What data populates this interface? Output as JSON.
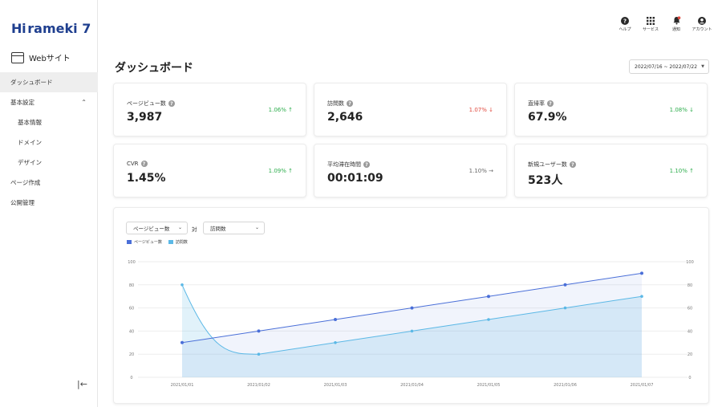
{
  "brand": {
    "logo_mark": "Hi",
    "logo_text": "rameki 7"
  },
  "site_switcher": {
    "label": "Webサイト"
  },
  "sidebar": {
    "items": [
      {
        "label": "ダッシュボード",
        "active": true
      },
      {
        "label": "基本設定",
        "expanded": true,
        "chevron": "chevron-up-icon"
      },
      {
        "label": "基本情報",
        "sub": true
      },
      {
        "label": "ドメイン",
        "sub": true
      },
      {
        "label": "デザイン",
        "sub": true
      },
      {
        "label": "ページ作成"
      },
      {
        "label": "公開管理"
      }
    ],
    "collapse_icon": "collapse-left-icon"
  },
  "top_actions": [
    {
      "label": "ヘルプ",
      "icon": "help-icon"
    },
    {
      "label": "サービス",
      "icon": "grid-icon"
    },
    {
      "label": "通知",
      "icon": "bell-icon"
    },
    {
      "label": "アカウント",
      "icon": "account-icon"
    }
  ],
  "page": {
    "title": "ダッシュボード",
    "date_range": "2022/07/16 ~ 2022/07/22"
  },
  "metrics": [
    {
      "label": "ページビュー数",
      "value": "3,987",
      "change": "1.06%",
      "trend": "up",
      "arrow": "↑"
    },
    {
      "label": "訪問数",
      "value": "2,646",
      "change": "1.07%",
      "trend": "down",
      "arrow": "↓"
    },
    {
      "label": "直帰率",
      "value": "67.9%",
      "change": "1.08%",
      "trend": "up",
      "arrow": "↓"
    },
    {
      "label": "CVR",
      "value": "1.45%",
      "change": "1.09%",
      "trend": "up",
      "arrow": "↑"
    },
    {
      "label": "平均滞在時間",
      "value": "00:01:09",
      "change": "1.10%",
      "trend": "flat",
      "arrow": "→"
    },
    {
      "label": "新規ユーザー数",
      "value": "523人",
      "change": "1.10%",
      "trend": "up",
      "arrow": "↑"
    }
  ],
  "chart_controls": {
    "metric_a": "ページビュー数",
    "vs_label": "対",
    "metric_b": "訪問数"
  },
  "chart_data": {
    "type": "area",
    "categories": [
      "2021/01/01",
      "2021/01/02",
      "2021/01/03",
      "2021/01/04",
      "2021/01/05",
      "2021/01/06",
      "2021/01/07"
    ],
    "series": [
      {
        "name": "ページビュー数",
        "values": [
          30,
          40,
          50,
          60,
          70,
          80,
          90
        ],
        "color": "#4a6fd8"
      },
      {
        "name": "訪問数",
        "values": [
          80,
          20,
          30,
          40,
          50,
          60,
          70
        ],
        "color": "#5bb8e6"
      }
    ],
    "ylim": [
      0,
      100
    ],
    "yticks": [
      0,
      20,
      40,
      60,
      80,
      100
    ],
    "grid": true,
    "legend": "top-left"
  },
  "colors": {
    "up": "#2fae4e",
    "down": "#e14a3f",
    "brand": "#1f3f8f"
  }
}
